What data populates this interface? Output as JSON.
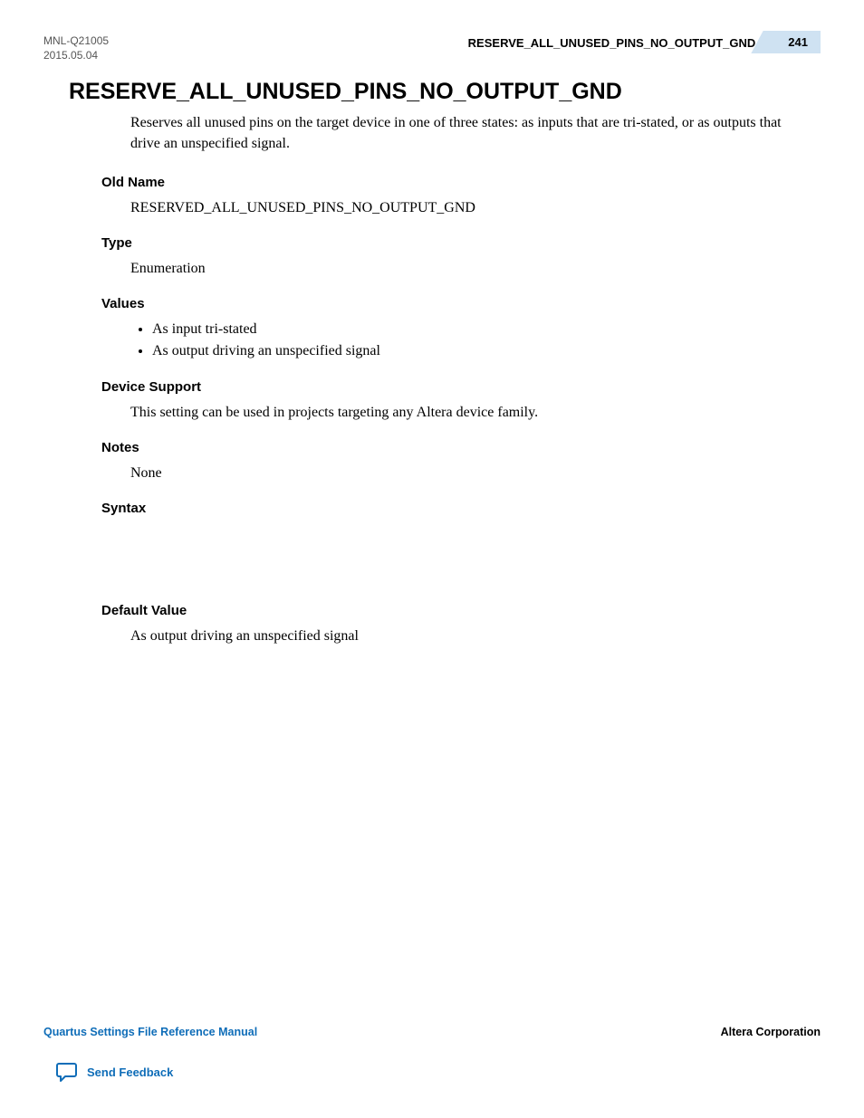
{
  "meta": {
    "doc_id": "MNL-Q21005",
    "date": "2015.05.04"
  },
  "header": {
    "breadcrumb": "RESERVE_ALL_UNUSED_PINS_NO_OUTPUT_GND",
    "page_number": "241"
  },
  "topic_title": "RESERVE_ALL_UNUSED_PINS_NO_OUTPUT_GND",
  "intro": "Reserves all unused pins on the target device in one of three states: as inputs that are tri-stated, or as outputs that drive an unspecified signal.",
  "sections": {
    "old_name": {
      "heading": "Old Name",
      "value": "RESERVED_ALL_UNUSED_PINS_NO_OUTPUT_GND"
    },
    "type": {
      "heading": "Type",
      "value": "Enumeration"
    },
    "values": {
      "heading": "Values",
      "items": [
        "As input tri-stated",
        "As output driving an unspecified signal"
      ]
    },
    "device_support": {
      "heading": "Device Support",
      "value": "This setting can be used in projects targeting any Altera device family."
    },
    "notes": {
      "heading": "Notes",
      "value": "None"
    },
    "syntax": {
      "heading": "Syntax"
    },
    "default_value": {
      "heading": "Default Value",
      "value": "As output driving an unspecified signal"
    }
  },
  "footer": {
    "manual_title": "Quartus Settings File Reference Manual",
    "company": "Altera Corporation",
    "feedback_label": "Send Feedback"
  }
}
